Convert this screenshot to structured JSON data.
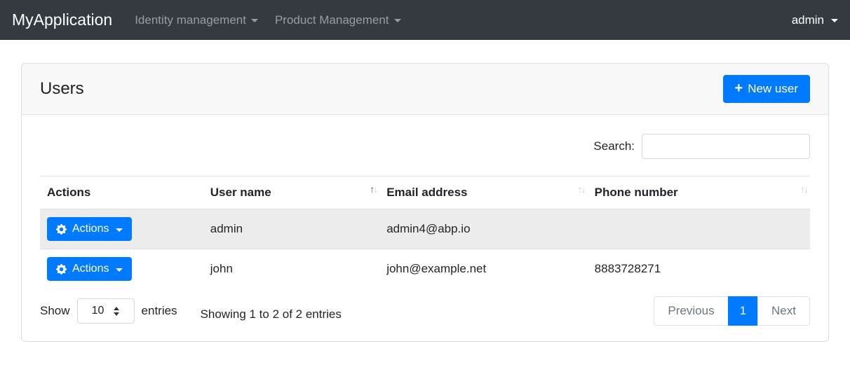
{
  "navbar": {
    "brand": "MyApplication",
    "menus": [
      {
        "label": "Identity management"
      },
      {
        "label": "Product Management"
      }
    ],
    "user": {
      "label": "admin"
    }
  },
  "card": {
    "title": "Users",
    "new_user": {
      "label": "New user",
      "plus": "+"
    }
  },
  "search": {
    "label": "Search:",
    "value": "",
    "placeholder": ""
  },
  "table": {
    "sort_icons": {
      "asc": "↑",
      "desc": "↓"
    },
    "actions_button": {
      "label": "Actions"
    },
    "columns": [
      {
        "label": "Actions",
        "sortable": false
      },
      {
        "label": "User name",
        "sortable": true,
        "sorted": "asc"
      },
      {
        "label": "Email address",
        "sortable": true
      },
      {
        "label": "Phone number",
        "sortable": true
      }
    ],
    "rows": [
      {
        "user_name": "admin",
        "email": "admin4@abp.io",
        "phone": ""
      },
      {
        "user_name": "john",
        "email": "john@example.net",
        "phone": "8883728271"
      }
    ]
  },
  "footer": {
    "show_label": "Show",
    "page_size": "10",
    "entries_label": "entries",
    "info": "Showing 1 to 2 of 2 entries",
    "pagination": {
      "previous": "Previous",
      "page": "1",
      "next": "Next"
    }
  },
  "colors": {
    "primary": "#007bff",
    "navbar_bg": "#343a40",
    "stripe": "#ececec"
  }
}
